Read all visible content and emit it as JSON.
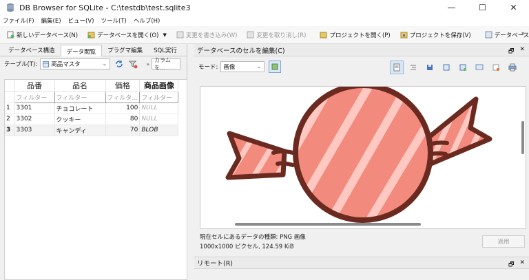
{
  "window": {
    "title": "DB Browser for SQLite - C:\\testdb\\test.sqlite3",
    "minimize": "—",
    "maximize": "☐",
    "close": "✕"
  },
  "menu": [
    "ファイル(F)",
    "編集(E)",
    "ビュー(V)",
    "ツール(T)",
    "ヘルプ(H)"
  ],
  "toolbar": {
    "new_db": "新しいデータベース(N)",
    "open_db": "データベースを開く(O)",
    "write_changes": "変更を書き込み(W)",
    "revert_changes": "変更を取り消し(R)",
    "open_project": "プロジェクトを開く(P)",
    "save_project": "プロジェクトを保存(V)",
    "attach_db": "データベースに接続(A)",
    "more": "»"
  },
  "tabs": [
    "データベース構造",
    "データ閲覧",
    "プラグマ編集",
    "SQL実行"
  ],
  "active_tab": 1,
  "browse": {
    "table_label": "テーブル(T):",
    "table_name": "商品マスタ",
    "find_label": "»",
    "find_placeholder": "カラムを…"
  },
  "grid": {
    "columns": [
      "品番",
      "品名",
      "価格",
      "商品画像"
    ],
    "filters": [
      "フィルター",
      "フィルター",
      "フィルタ…",
      "フィルター"
    ],
    "rows": [
      {
        "num": "1",
        "code": "3301",
        "name": "チョコレート",
        "price": "100",
        "image": "NULL"
      },
      {
        "num": "2",
        "code": "3302",
        "name": "クッキー",
        "price": "80",
        "image": "NULL"
      },
      {
        "num": "3",
        "code": "3303",
        "name": "キャンディ",
        "price": "70",
        "image": "BLOB"
      }
    ]
  },
  "cell_editor": {
    "title": "データベースのセルを編集(C)",
    "mode_label": "モード:",
    "mode_value": "画像",
    "info_line1": "現在セルにあるデータの種類: PNG 画像",
    "info_line2": "1000x1000 ピクセル, 124.59 KiB",
    "apply": "適用",
    "dock_float": "🗗",
    "dock_close": "✕"
  },
  "remote": {
    "title": "リモート(R)"
  },
  "colors": {
    "candy_fill": "#f28a7e",
    "candy_stripe": "#ffc9c2",
    "candy_outline": "#6b2a1f"
  }
}
